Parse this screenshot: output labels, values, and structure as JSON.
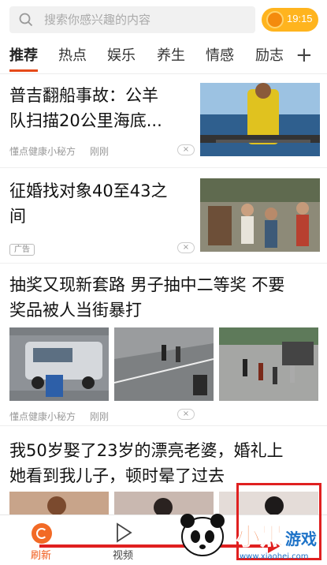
{
  "search": {
    "placeholder": "搜索你感兴趣的内容"
  },
  "clock": {
    "time": "19:15"
  },
  "tabs": [
    "推荐",
    "热点",
    "娱乐",
    "养生",
    "情感",
    "励志"
  ],
  "tabs_more": "+",
  "feed": [
    {
      "title_line1": "普吉翻船事故：公羊",
      "title_line2": "队扫描20公里海底...",
      "source": "懂点健康小秘方",
      "time": "刚刚",
      "close": "×"
    },
    {
      "title_line1": "征婚找对象40至43之",
      "title_line2": "间",
      "ad": "广告",
      "close": "×"
    },
    {
      "title_line1": "抽奖又现新套路 男子抽中二等奖 不要",
      "title_line2": "奖品被人当街暴打",
      "source": "懂点健康小秘方",
      "time": "刚刚",
      "close": "×"
    },
    {
      "title_line1": "我50岁娶了23岁的漂亮老婆，婚礼上",
      "title_line2": "她看到我儿子，顿时晕了过去"
    }
  ],
  "bottomnav": {
    "refresh": "刷新",
    "video": "视频"
  },
  "watermark": {
    "brand": "小黑游戏",
    "url": "www.xiaohei.com"
  },
  "colors": {
    "accent": "#e64a19",
    "orange": "#f26a26",
    "annotation_red": "#e02020"
  }
}
